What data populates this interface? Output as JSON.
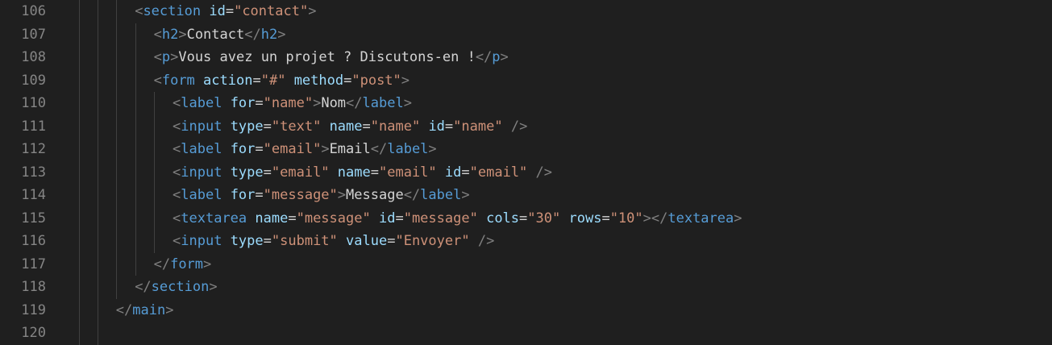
{
  "editor": {
    "language": "html",
    "colors": {
      "background": "#1f1f1f",
      "line_number": "#858585",
      "punctuation": "#808080",
      "tag": "#569cd6",
      "attribute": "#9cdcfe",
      "string": "#ce9178",
      "text": "#d4d4d4",
      "indent_guide": "#404040"
    },
    "lines": [
      {
        "number": "106",
        "indent": 3,
        "tokens": [
          {
            "t": "pu",
            "v": "<"
          },
          {
            "t": "tg",
            "v": "section"
          },
          {
            "t": "tx",
            "v": " "
          },
          {
            "t": "at",
            "v": "id"
          },
          {
            "t": "tx",
            "v": "="
          },
          {
            "t": "st",
            "v": "\"contact\""
          },
          {
            "t": "pu",
            "v": ">"
          }
        ]
      },
      {
        "number": "107",
        "indent": 4,
        "tokens": [
          {
            "t": "pu",
            "v": "<"
          },
          {
            "t": "tg",
            "v": "h2"
          },
          {
            "t": "pu",
            "v": ">"
          },
          {
            "t": "tx",
            "v": "Contact"
          },
          {
            "t": "pu",
            "v": "</"
          },
          {
            "t": "tg",
            "v": "h2"
          },
          {
            "t": "pu",
            "v": ">"
          }
        ]
      },
      {
        "number": "108",
        "indent": 4,
        "tokens": [
          {
            "t": "pu",
            "v": "<"
          },
          {
            "t": "tg",
            "v": "p"
          },
          {
            "t": "pu",
            "v": ">"
          },
          {
            "t": "tx",
            "v": "Vous avez un projet ? Discutons-en !"
          },
          {
            "t": "pu",
            "v": "</"
          },
          {
            "t": "tg",
            "v": "p"
          },
          {
            "t": "pu",
            "v": ">"
          }
        ]
      },
      {
        "number": "109",
        "indent": 4,
        "tokens": [
          {
            "t": "pu",
            "v": "<"
          },
          {
            "t": "tg",
            "v": "form"
          },
          {
            "t": "tx",
            "v": " "
          },
          {
            "t": "at",
            "v": "action"
          },
          {
            "t": "tx",
            "v": "="
          },
          {
            "t": "st",
            "v": "\"#\""
          },
          {
            "t": "tx",
            "v": " "
          },
          {
            "t": "at",
            "v": "method"
          },
          {
            "t": "tx",
            "v": "="
          },
          {
            "t": "st",
            "v": "\"post\""
          },
          {
            "t": "pu",
            "v": ">"
          }
        ]
      },
      {
        "number": "110",
        "indent": 5,
        "tokens": [
          {
            "t": "pu",
            "v": "<"
          },
          {
            "t": "tg",
            "v": "label"
          },
          {
            "t": "tx",
            "v": " "
          },
          {
            "t": "at",
            "v": "for"
          },
          {
            "t": "tx",
            "v": "="
          },
          {
            "t": "st",
            "v": "\"name\""
          },
          {
            "t": "pu",
            "v": ">"
          },
          {
            "t": "tx",
            "v": "Nom"
          },
          {
            "t": "pu",
            "v": "</"
          },
          {
            "t": "tg",
            "v": "label"
          },
          {
            "t": "pu",
            "v": ">"
          }
        ]
      },
      {
        "number": "111",
        "indent": 5,
        "tokens": [
          {
            "t": "pu",
            "v": "<"
          },
          {
            "t": "tg",
            "v": "input"
          },
          {
            "t": "tx",
            "v": " "
          },
          {
            "t": "at",
            "v": "type"
          },
          {
            "t": "tx",
            "v": "="
          },
          {
            "t": "st",
            "v": "\"text\""
          },
          {
            "t": "tx",
            "v": " "
          },
          {
            "t": "at",
            "v": "name"
          },
          {
            "t": "tx",
            "v": "="
          },
          {
            "t": "st",
            "v": "\"name\""
          },
          {
            "t": "tx",
            "v": " "
          },
          {
            "t": "at",
            "v": "id"
          },
          {
            "t": "tx",
            "v": "="
          },
          {
            "t": "st",
            "v": "\"name\""
          },
          {
            "t": "tx",
            "v": " "
          },
          {
            "t": "pu",
            "v": "/>"
          }
        ]
      },
      {
        "number": "112",
        "indent": 5,
        "tokens": [
          {
            "t": "pu",
            "v": "<"
          },
          {
            "t": "tg",
            "v": "label"
          },
          {
            "t": "tx",
            "v": " "
          },
          {
            "t": "at",
            "v": "for"
          },
          {
            "t": "tx",
            "v": "="
          },
          {
            "t": "st",
            "v": "\"email\""
          },
          {
            "t": "pu",
            "v": ">"
          },
          {
            "t": "tx",
            "v": "Email"
          },
          {
            "t": "pu",
            "v": "</"
          },
          {
            "t": "tg",
            "v": "label"
          },
          {
            "t": "pu",
            "v": ">"
          }
        ]
      },
      {
        "number": "113",
        "indent": 5,
        "tokens": [
          {
            "t": "pu",
            "v": "<"
          },
          {
            "t": "tg",
            "v": "input"
          },
          {
            "t": "tx",
            "v": " "
          },
          {
            "t": "at",
            "v": "type"
          },
          {
            "t": "tx",
            "v": "="
          },
          {
            "t": "st",
            "v": "\"email\""
          },
          {
            "t": "tx",
            "v": " "
          },
          {
            "t": "at",
            "v": "name"
          },
          {
            "t": "tx",
            "v": "="
          },
          {
            "t": "st",
            "v": "\"email\""
          },
          {
            "t": "tx",
            "v": " "
          },
          {
            "t": "at",
            "v": "id"
          },
          {
            "t": "tx",
            "v": "="
          },
          {
            "t": "st",
            "v": "\"email\""
          },
          {
            "t": "tx",
            "v": " "
          },
          {
            "t": "pu",
            "v": "/>"
          }
        ]
      },
      {
        "number": "114",
        "indent": 5,
        "tokens": [
          {
            "t": "pu",
            "v": "<"
          },
          {
            "t": "tg",
            "v": "label"
          },
          {
            "t": "tx",
            "v": " "
          },
          {
            "t": "at",
            "v": "for"
          },
          {
            "t": "tx",
            "v": "="
          },
          {
            "t": "st",
            "v": "\"message\""
          },
          {
            "t": "pu",
            "v": ">"
          },
          {
            "t": "tx",
            "v": "Message"
          },
          {
            "t": "pu",
            "v": "</"
          },
          {
            "t": "tg",
            "v": "label"
          },
          {
            "t": "pu",
            "v": ">"
          }
        ]
      },
      {
        "number": "115",
        "indent": 5,
        "tokens": [
          {
            "t": "pu",
            "v": "<"
          },
          {
            "t": "tg",
            "v": "textarea"
          },
          {
            "t": "tx",
            "v": " "
          },
          {
            "t": "at",
            "v": "name"
          },
          {
            "t": "tx",
            "v": "="
          },
          {
            "t": "st",
            "v": "\"message\""
          },
          {
            "t": "tx",
            "v": " "
          },
          {
            "t": "at",
            "v": "id"
          },
          {
            "t": "tx",
            "v": "="
          },
          {
            "t": "st",
            "v": "\"message\""
          },
          {
            "t": "tx",
            "v": " "
          },
          {
            "t": "at",
            "v": "cols"
          },
          {
            "t": "tx",
            "v": "="
          },
          {
            "t": "st",
            "v": "\"30\""
          },
          {
            "t": "tx",
            "v": " "
          },
          {
            "t": "at",
            "v": "rows"
          },
          {
            "t": "tx",
            "v": "="
          },
          {
            "t": "st",
            "v": "\"10\""
          },
          {
            "t": "pu",
            "v": "></"
          },
          {
            "t": "tg",
            "v": "textarea"
          },
          {
            "t": "pu",
            "v": ">"
          }
        ]
      },
      {
        "number": "116",
        "indent": 5,
        "tokens": [
          {
            "t": "pu",
            "v": "<"
          },
          {
            "t": "tg",
            "v": "input"
          },
          {
            "t": "tx",
            "v": " "
          },
          {
            "t": "at",
            "v": "type"
          },
          {
            "t": "tx",
            "v": "="
          },
          {
            "t": "st",
            "v": "\"submit\""
          },
          {
            "t": "tx",
            "v": " "
          },
          {
            "t": "at",
            "v": "value"
          },
          {
            "t": "tx",
            "v": "="
          },
          {
            "t": "st",
            "v": "\"Envoyer\""
          },
          {
            "t": "tx",
            "v": " "
          },
          {
            "t": "pu",
            "v": "/>"
          }
        ]
      },
      {
        "number": "117",
        "indent": 4,
        "tokens": [
          {
            "t": "pu",
            "v": "</"
          },
          {
            "t": "tg",
            "v": "form"
          },
          {
            "t": "pu",
            "v": ">"
          }
        ]
      },
      {
        "number": "118",
        "indent": 3,
        "tokens": [
          {
            "t": "pu",
            "v": "</"
          },
          {
            "t": "tg",
            "v": "section"
          },
          {
            "t": "pu",
            "v": ">"
          }
        ]
      },
      {
        "number": "119",
        "indent": 2,
        "tokens": [
          {
            "t": "pu",
            "v": "</"
          },
          {
            "t": "tg",
            "v": "main"
          },
          {
            "t": "pu",
            "v": ">"
          }
        ]
      },
      {
        "number": "120",
        "indent": 2,
        "tokens": []
      }
    ]
  }
}
